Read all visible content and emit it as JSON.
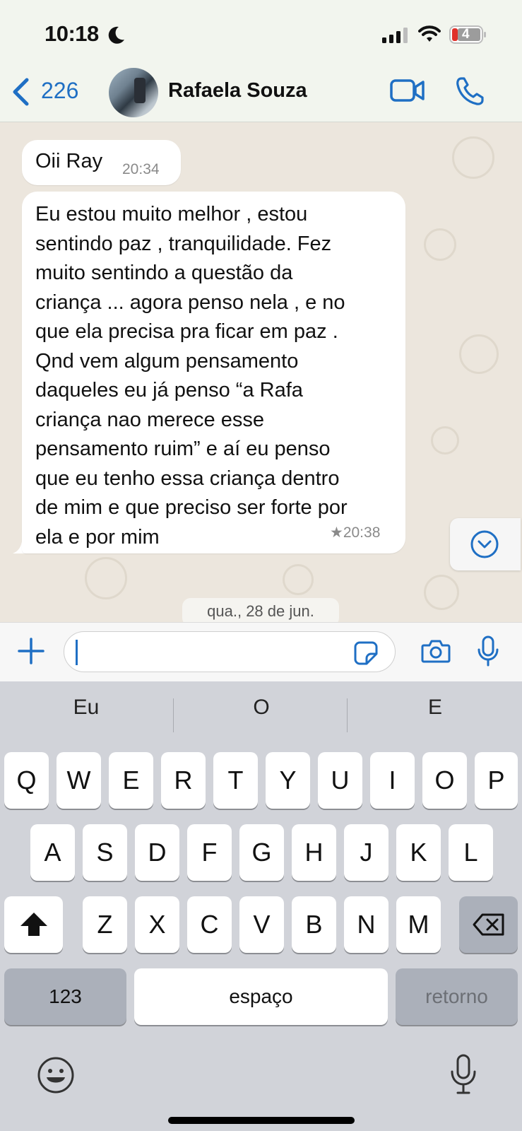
{
  "status_bar": {
    "time": "10:18",
    "battery_level": "4"
  },
  "header": {
    "back_count": "226",
    "contact_name": "Rafaela Souza"
  },
  "messages": [
    {
      "text": "Oii Ray",
      "time": "20:34"
    },
    {
      "text": "Eu estou muito melhor , estou\nsentindo paz , tranquilidade. Fez\nmuito sentindo a questão da\ncriança ... agora penso nela , e no\nque ela precisa pra ficar em paz .\nQnd vem algum pensamento\ndaqueles eu já penso “a Rafa\ncriança nao merece esse\npensamento ruim” e aí eu penso\nque eu tenho essa criança dentro\nde mim e que preciso ser forte por\nela e por mim",
      "starred_time": "★20:38"
    }
  ],
  "date_chip": "qua., 28 de jun.",
  "input": {
    "value": ""
  },
  "keyboard": {
    "suggestions": [
      "Eu",
      "O",
      "E"
    ],
    "row1": [
      "Q",
      "W",
      "E",
      "R",
      "T",
      "Y",
      "U",
      "I",
      "O",
      "P"
    ],
    "row2": [
      "A",
      "S",
      "D",
      "F",
      "G",
      "H",
      "J",
      "K",
      "L"
    ],
    "row3": [
      "Z",
      "X",
      "C",
      "V",
      "B",
      "N",
      "M"
    ],
    "numbers_key": "123",
    "space_key": "espaço",
    "return_key": "retorno"
  },
  "colors": {
    "accent": "#1f6fc4",
    "chat_bg": "#ece6dd",
    "header_bg": "#f2f5ee"
  }
}
